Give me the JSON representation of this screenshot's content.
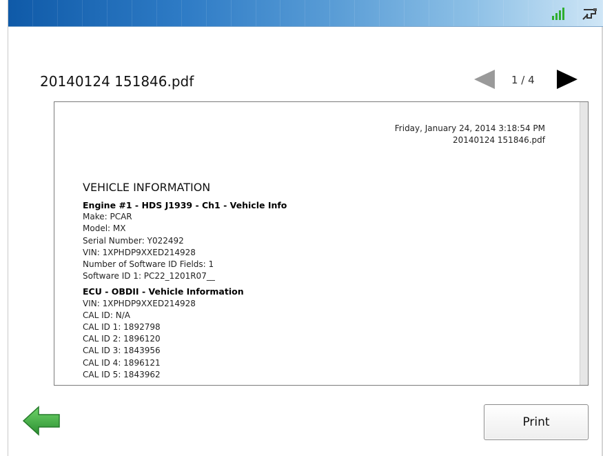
{
  "file": {
    "title": "20140124 151846.pdf",
    "page_indicator": "1 / 4"
  },
  "document": {
    "date_line": "Friday, January 24, 2014 3:18:54 PM",
    "file_line": "20140124 151846.pdf",
    "heading": "VEHICLE INFORMATION",
    "sections": [
      {
        "title": "Engine #1 - HDS J1939 - Ch1 - Vehicle Info",
        "lines": [
          "Make: PCAR",
          "Model: MX",
          "Serial Number: Y022492",
          "VIN: 1XPHDP9XXED214928",
          "Number of Software ID Fields: 1",
          "Software ID 1: PC22_1201R07__"
        ]
      },
      {
        "title": "ECU - OBDII - Vehicle Information",
        "lines": [
          "VIN: 1XPHDP9XXED214928",
          "CAL ID: N/A",
          "CAL ID 1: 1892798",
          "CAL ID 2: 1896120",
          "CAL ID 3: 1843956",
          "CAL ID 4: 1896121",
          "CAL ID 5: 1843962"
        ]
      }
    ]
  },
  "buttons": {
    "print_label": "Print"
  },
  "icons": {
    "signal": "signal-strength-icon",
    "cable": "cable-connection-icon",
    "prev": "previous-page-arrow-icon",
    "next": "next-page-arrow-icon",
    "back": "back-arrow-icon"
  },
  "colors": {
    "topbar_start": "#0f5aa8",
    "topbar_end": "#cfe6f6",
    "signal": "#2fae2f",
    "back_arrow": "#35a23a",
    "prev_disabled": "#9a9a9a",
    "next_active": "#000000"
  }
}
